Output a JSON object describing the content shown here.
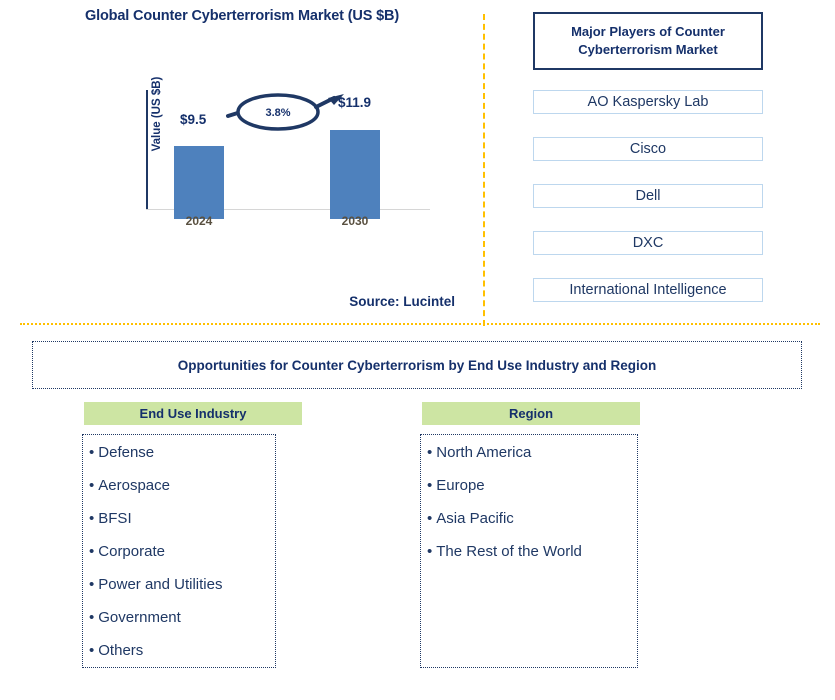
{
  "chart_panel": {
    "title": "Global Counter Cyberterrorism Market (US $B)",
    "y_axis_label": "Value (US $B)",
    "source": "Source: Lucintel"
  },
  "chart_data": {
    "type": "bar",
    "title": "Global Counter Cyberterrorism Market (US $B)",
    "categories": [
      "2024",
      "2030"
    ],
    "values": [
      9.5,
      11.9
    ],
    "value_labels": [
      "$9.5",
      "$11.9"
    ],
    "cagr_label": "3.8%",
    "xlabel": "",
    "ylabel": "Value (US $B)",
    "ylim": [
      0,
      13
    ],
    "grid": false,
    "legend": "none",
    "bar_color": "#4E81BD",
    "annotations": [
      {
        "text": "3.8%",
        "shape": "ellipse",
        "arrow": "from 2024 bar label to 2030 bar label"
      }
    ],
    "source": "Source: Lucintel"
  },
  "players_panel": {
    "header": "Major Players of Counter Cyberterrorism Market",
    "items": [
      "AO Kaspersky Lab",
      "Cisco",
      "Dell",
      "DXC",
      "International Intelligence"
    ]
  },
  "opportunities": {
    "banner": "Opportunities for Counter Cyberterrorism by End Use Industry and Region",
    "columns": [
      {
        "header": "End Use Industry",
        "items": [
          "Defense",
          "Aerospace",
          "BFSI",
          "Corporate",
          "Power and Utilities",
          "Government",
          "Others"
        ]
      },
      {
        "header": "Region",
        "items": [
          "North America",
          "Europe",
          "Asia Pacific",
          "The Rest of the World"
        ]
      }
    ]
  },
  "colors": {
    "navy": "#1F3864",
    "title_navy": "#15306B",
    "bar_blue": "#4E81BD",
    "divider_gold": "#FFC000",
    "header_green": "#CDE5A3",
    "player_border": "#BDD7EE"
  }
}
